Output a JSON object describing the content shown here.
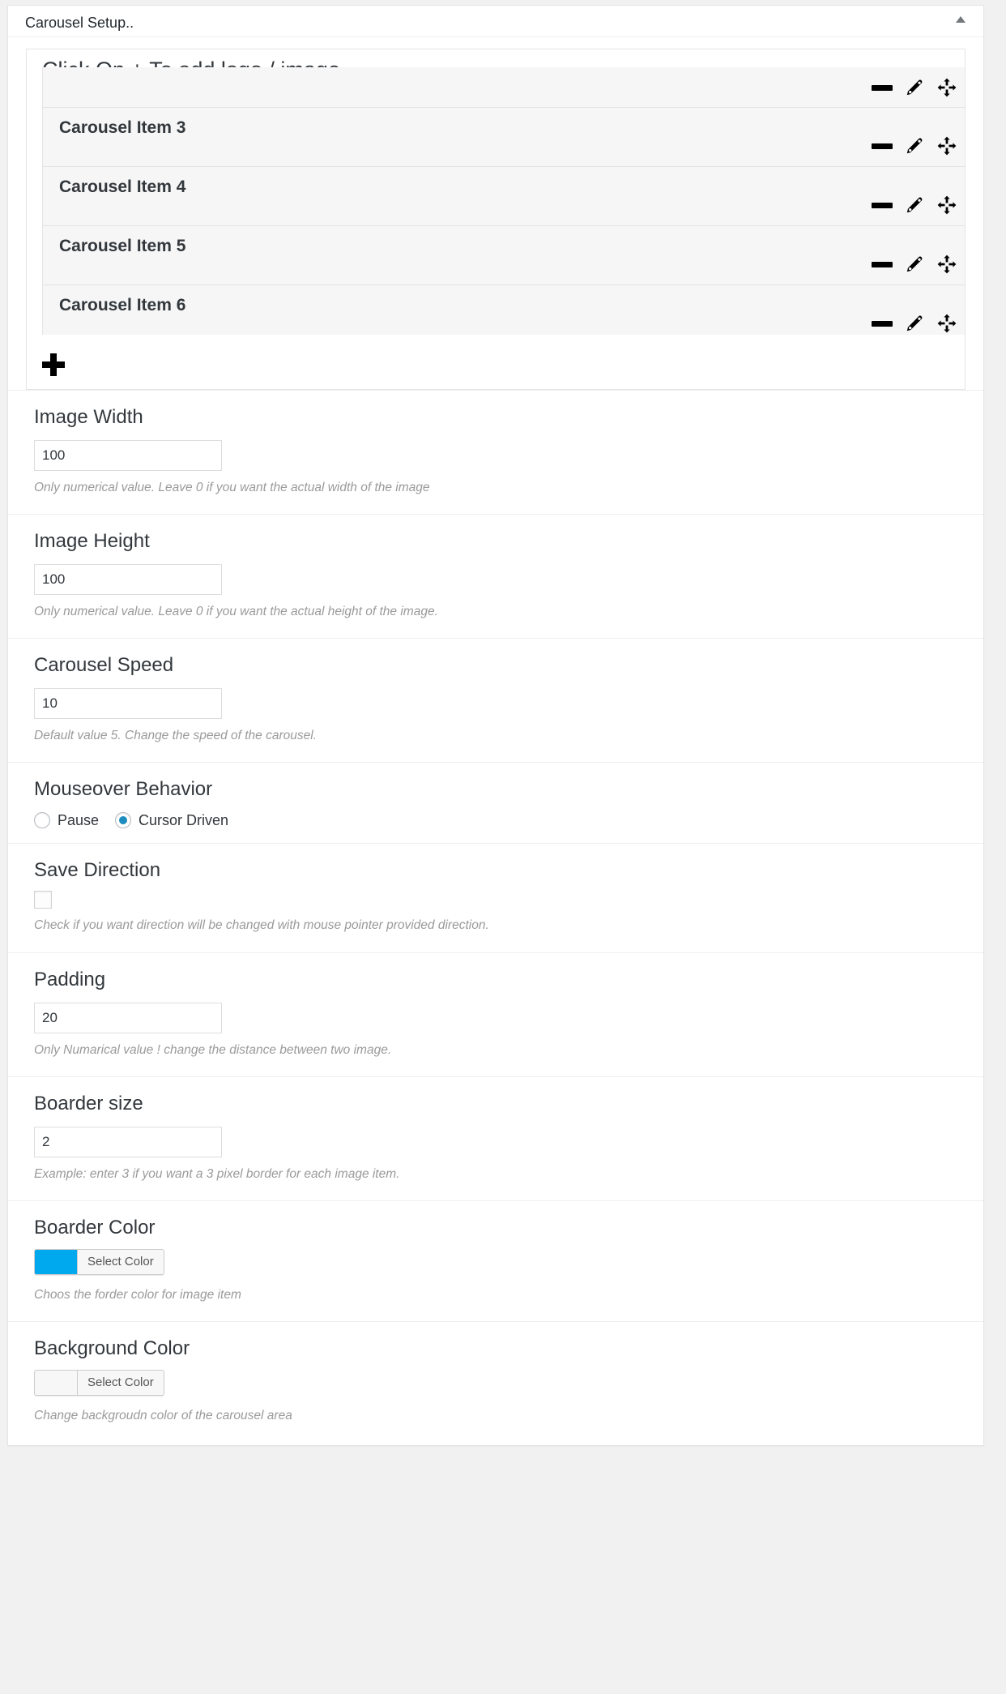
{
  "panel": {
    "title": "Carousel Setup..",
    "toggle_icon": "triangle-up-icon"
  },
  "repeater": {
    "heading": "Click On + To add logo / image",
    "add_icon": "plus-icon",
    "item_action_icons": {
      "remove": "minus-icon",
      "edit": "pencil-icon",
      "move": "arrows-move-icon"
    },
    "items": [
      {
        "label": ""
      },
      {
        "label": "Carousel Item 3"
      },
      {
        "label": "Carousel Item 4"
      },
      {
        "label": "Carousel Item 5"
      },
      {
        "label": "Carousel Item 6"
      }
    ]
  },
  "fields": {
    "image_width": {
      "label": "Image Width",
      "value": "100",
      "description": "Only numerical value. Leave 0 if you want the actual width of the image"
    },
    "image_height": {
      "label": "Image Height",
      "value": "100",
      "description": "Only numerical value. Leave 0 if you want the actual height of the image."
    },
    "carousel_speed": {
      "label": "Carousel Speed",
      "value": "10",
      "description": "Default value 5. Change the speed of the carousel."
    },
    "mouseover_behavior": {
      "label": "Mouseover Behavior",
      "options": [
        {
          "label": "Pause",
          "selected": false
        },
        {
          "label": "Cursor Driven",
          "selected": true
        }
      ]
    },
    "save_direction": {
      "label": "Save Direction",
      "checked": false,
      "description": "Check if you want direction will be changed with mouse pointer provided direction."
    },
    "padding": {
      "label": "Padding",
      "value": "20",
      "description": "Only Numarical value ! change the distance between two image."
    },
    "boarder_size": {
      "label": "Boarder size",
      "value": "2",
      "description": "Example: enter 3 if you want a 3 pixel border for each image item."
    },
    "boarder_color": {
      "label": "Boarder Color",
      "button_label": "Select Color",
      "swatch": "#00a8ee",
      "description": "Choos the forder color for image item"
    },
    "background_color": {
      "label": "Background Color",
      "button_label": "Select Color",
      "swatch": "#f7f7f7",
      "description": "Change backgroudn color of the carousel area"
    }
  }
}
